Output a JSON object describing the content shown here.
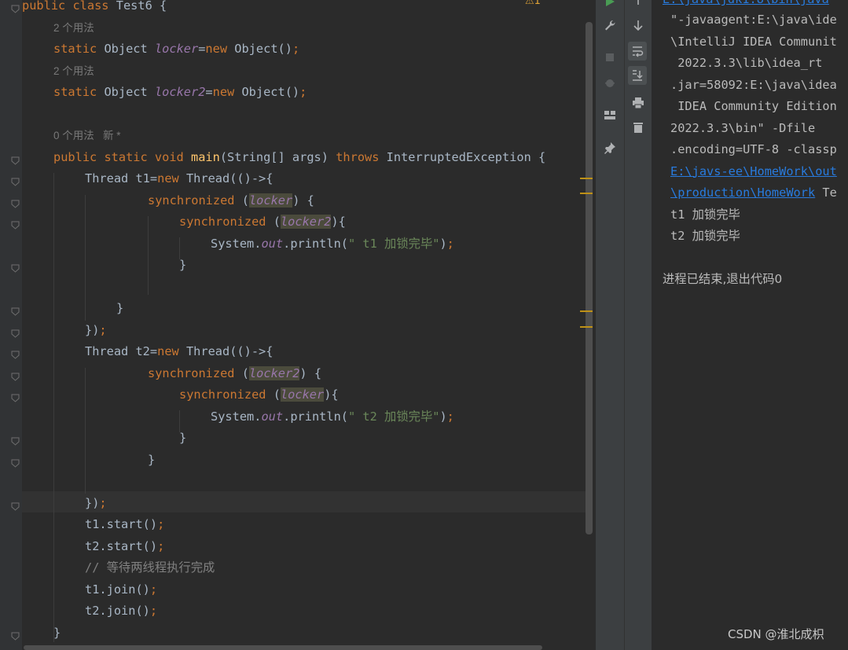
{
  "editor": {
    "lines": [
      {
        "kind": "code",
        "tokens": [
          {
            "t": "public class ",
            "c": "kw"
          },
          {
            "t": "Test6 {"
          }
        ]
      },
      {
        "kind": "hint",
        "text": "2 个用法"
      },
      {
        "kind": "code",
        "tokens": [
          {
            "t": "static ",
            "c": "kw"
          },
          {
            "t": "Object "
          },
          {
            "t": "locker",
            "c": "fld"
          },
          {
            "t": "="
          },
          {
            "t": "new ",
            "c": "kw"
          },
          {
            "t": "Object()"
          },
          {
            "t": ";",
            "c": "kw"
          }
        ]
      },
      {
        "kind": "hint",
        "text": "2 个用法"
      },
      {
        "kind": "code",
        "tokens": [
          {
            "t": "static ",
            "c": "kw"
          },
          {
            "t": "Object "
          },
          {
            "t": "locker2",
            "c": "fld"
          },
          {
            "t": "="
          },
          {
            "t": "new ",
            "c": "kw"
          },
          {
            "t": "Object()"
          },
          {
            "t": ";",
            "c": "kw"
          }
        ]
      },
      {
        "kind": "blank"
      },
      {
        "kind": "hint",
        "text": "0 个用法   新 *"
      },
      {
        "kind": "code",
        "tokens": [
          {
            "t": "public static void ",
            "c": "kw"
          },
          {
            "t": "main",
            "c": "fn"
          },
          {
            "t": "(String[] args) "
          },
          {
            "t": "throws ",
            "c": "kw"
          },
          {
            "t": "InterruptedException {"
          }
        ]
      },
      {
        "kind": "code",
        "tokens": [
          {
            "t": "Thread t1="
          },
          {
            "t": "new ",
            "c": "kw"
          },
          {
            "t": "Thread(()->{"
          }
        ]
      },
      {
        "kind": "code",
        "tokens": [
          {
            "t": "synchronized ",
            "c": "kw"
          },
          {
            "t": "("
          },
          {
            "t": "locker",
            "c": "fld hl"
          },
          {
            "t": ") {"
          }
        ]
      },
      {
        "kind": "code",
        "tokens": [
          {
            "t": "synchronized ",
            "c": "kw"
          },
          {
            "t": "("
          },
          {
            "t": "locker2",
            "c": "fld hl"
          },
          {
            "t": "){"
          }
        ]
      },
      {
        "kind": "code",
        "tokens": [
          {
            "t": "System."
          },
          {
            "t": "out",
            "c": "fld"
          },
          {
            "t": ".println("
          },
          {
            "t": "\" t1 加锁完毕\"",
            "c": "str"
          },
          {
            "t": ")"
          },
          {
            "t": ";",
            "c": "kw"
          }
        ]
      },
      {
        "kind": "code",
        "tokens": [
          {
            "t": "}"
          }
        ]
      },
      {
        "kind": "blank"
      },
      {
        "kind": "code",
        "tokens": [
          {
            "t": "}"
          }
        ]
      },
      {
        "kind": "code",
        "tokens": [
          {
            "t": "})"
          },
          {
            "t": ";",
            "c": "kw"
          }
        ]
      },
      {
        "kind": "code",
        "tokens": [
          {
            "t": "Thread t2="
          },
          {
            "t": "new ",
            "c": "kw"
          },
          {
            "t": "Thread(()->{"
          }
        ]
      },
      {
        "kind": "code",
        "tokens": [
          {
            "t": "synchronized ",
            "c": "kw"
          },
          {
            "t": "("
          },
          {
            "t": "locker2",
            "c": "fld hl"
          },
          {
            "t": ") {"
          }
        ]
      },
      {
        "kind": "code",
        "tokens": [
          {
            "t": "synchronized ",
            "c": "kw"
          },
          {
            "t": "("
          },
          {
            "t": "locker",
            "c": "fld hl"
          },
          {
            "t": "){"
          }
        ]
      },
      {
        "kind": "code",
        "tokens": [
          {
            "t": "System."
          },
          {
            "t": "out",
            "c": "fld"
          },
          {
            "t": ".println("
          },
          {
            "t": "\" t2 加锁完毕\"",
            "c": "str"
          },
          {
            "t": ")"
          },
          {
            "t": ";",
            "c": "kw"
          }
        ]
      },
      {
        "kind": "code",
        "tokens": [
          {
            "t": "}"
          }
        ]
      },
      {
        "kind": "code",
        "tokens": [
          {
            "t": "}"
          }
        ]
      },
      {
        "kind": "blank"
      },
      {
        "kind": "code",
        "tokens": [
          {
            "t": "})"
          },
          {
            "t": ";",
            "c": "kw"
          }
        ]
      },
      {
        "kind": "code",
        "tokens": [
          {
            "t": "t1.start()"
          },
          {
            "t": ";",
            "c": "kw"
          }
        ]
      },
      {
        "kind": "code",
        "tokens": [
          {
            "t": "t2.start()"
          },
          {
            "t": ";",
            "c": "kw"
          }
        ]
      },
      {
        "kind": "code",
        "tokens": [
          {
            "t": "// 等待两线程执行完成",
            "c": "cmt"
          }
        ]
      },
      {
        "kind": "code",
        "tokens": [
          {
            "t": "t1.join()"
          },
          {
            "t": ";",
            "c": "kw"
          }
        ]
      },
      {
        "kind": "code",
        "tokens": [
          {
            "t": "t2.join()"
          },
          {
            "t": ";",
            "c": "kw"
          }
        ]
      },
      {
        "kind": "code",
        "tokens": [
          {
            "t": "}"
          }
        ]
      }
    ]
  },
  "run_toolbar": {
    "icons": [
      "run-icon",
      "wrench-icon",
      "stop-icon",
      "debug-icon",
      "layout-icon",
      "pin-icon"
    ]
  },
  "console_toolbar": {
    "icons": [
      "up-arrow-icon",
      "down-arrow-icon",
      "soft-wrap-icon",
      "scroll-to-end-icon",
      "print-icon",
      "trash-icon"
    ]
  },
  "console": {
    "lines": [
      {
        "text": "\"-javaagent:E:\\java\\ide"
      },
      {
        "text": "\\IntelliJ IDEA Communit"
      },
      {
        "text": " 2022.3.3\\lib\\idea_rt"
      },
      {
        "text": ".jar=58092:E:\\java\\idea"
      },
      {
        "text": " IDEA Community Edition"
      },
      {
        "text": "2022.3.3\\bin\" -Dfile"
      },
      {
        "text": ".encoding=UTF-8 -classp"
      },
      {
        "text": "E:\\javs-ee\\HomeWork\\out",
        "link": true
      },
      {
        "text": "\\production\\HomeWork",
        "link": true,
        "suffix": " Te"
      },
      {
        "text": "t1 加锁完毕"
      },
      {
        "text": "t2 加锁完毕"
      },
      {
        "text": ""
      },
      {
        "text": "进程已结束,退出代码0",
        "exit": true
      }
    ]
  },
  "watermark": "CSDN @淮北成枳",
  "warning_indicator": "⚠1"
}
